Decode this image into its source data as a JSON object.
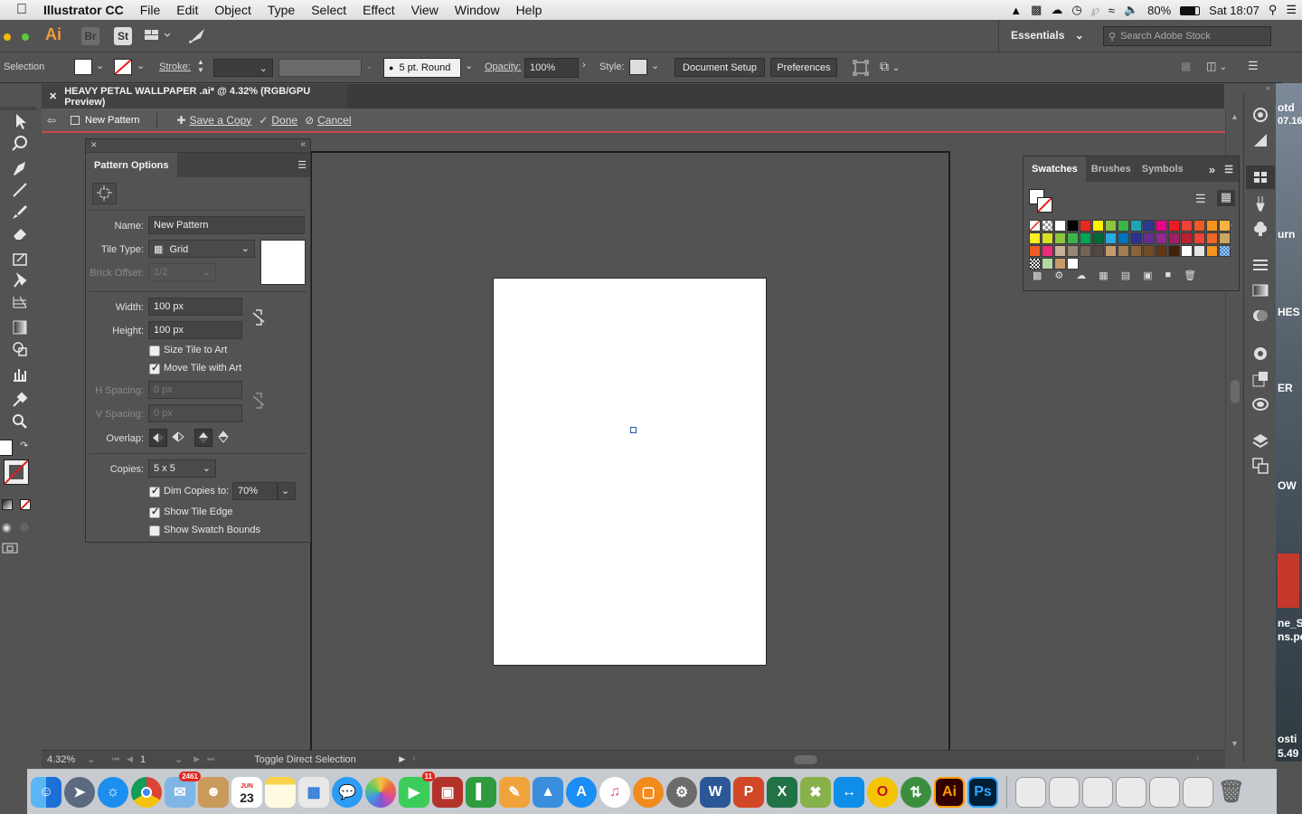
{
  "menubar": {
    "app_name": "Illustrator CC",
    "items": [
      "File",
      "Edit",
      "Object",
      "Type",
      "Select",
      "Effect",
      "View",
      "Window",
      "Help"
    ],
    "battery": "80%",
    "clock": "Sat 18:07"
  },
  "appbar": {
    "ai_logo": "Ai",
    "br": "Br",
    "st": "St",
    "workspace": "Essentials",
    "stock_search_placeholder": "Search Adobe Stock"
  },
  "control": {
    "mode": "Selection",
    "stroke_label": "Stroke:",
    "brush": "5 pt. Round",
    "opacity_label": "Opacity:",
    "opacity_value": "100%",
    "style_label": "Style:",
    "document_setup": "Document Setup",
    "preferences": "Preferences"
  },
  "document": {
    "tab_title": "HEAVY PETAL WALLPAPER .ai* @ 4.32% (RGB/GPU Preview)",
    "isolation_label": "New Pattern",
    "save_copy": "Save a Copy",
    "done": "Done",
    "cancel": "Cancel"
  },
  "pattern_options": {
    "title": "Pattern Options",
    "name_label": "Name:",
    "name_value": "New Pattern",
    "tile_type_label": "Tile Type:",
    "tile_type_value": "Grid",
    "brick_offset_label": "Brick Offset:",
    "brick_offset_value": "1/2",
    "width_label": "Width:",
    "width_value": "100 px",
    "height_label": "Height:",
    "height_value": "100 px",
    "size_tile_to_art": "Size Tile to Art",
    "move_tile_with_art": "Move Tile with Art",
    "h_spacing_label": "H Spacing:",
    "h_spacing_value": "0 px",
    "v_spacing_label": "V Spacing:",
    "v_spacing_value": "0 px",
    "overlap_label": "Overlap:",
    "copies_label": "Copies:",
    "copies_value": "5 x 5",
    "dim_copies_label": "Dim Copies to:",
    "dim_copies_value": "70%",
    "show_tile_edge": "Show Tile Edge",
    "show_swatch_bounds": "Show Swatch Bounds",
    "checks": {
      "size_tile_to_art": false,
      "move_tile_with_art": true,
      "dim_copies": true,
      "show_tile_edge": true,
      "show_swatch_bounds": false
    }
  },
  "swatches": {
    "tabs": [
      "Swatches",
      "Brushes",
      "Symbols"
    ],
    "rows": [
      [
        "#ffffff",
        "#ffffff",
        "#ffffff",
        "#000000",
        "#e8271f",
        "#fff200",
        "#8dc63f",
        "#39b54a",
        "#1fa3b6",
        "#2b3990",
        "#ec008c",
        "#ed1c24",
        "#ef4136",
        "#f15a24",
        "#f7941d",
        "#fbb040"
      ],
      [
        "#fcee21",
        "#d7df23",
        "#8cc63f",
        "#39b54a",
        "#00a651",
        "#006838",
        "#29abe2",
        "#0071bc",
        "#2e3192",
        "#662d91",
        "#92278f",
        "#9e1f63",
        "#be1e2d",
        "#ef4136",
        "#f26522",
        "#c8a95f"
      ],
      [
        "#f15a24",
        "#ee2a7b",
        "#c7b299",
        "#998675",
        "#736357",
        "#534741",
        "#c69c6d",
        "#a67c52",
        "#8c6239",
        "#754c24",
        "#603813",
        "#42210b",
        "#ffffff",
        "#e6e6e6",
        "#f7931e",
        "#8dc6ff"
      ],
      [
        "#ffffff",
        "#b3d9a0",
        "#c49a6c",
        "#ffffff"
      ]
    ]
  },
  "right_desktop_text": [
    "otd",
    "07.16",
    "urn",
    "HES",
    "ER",
    "OW",
    "ne_S",
    "ns.pc",
    "osti",
    "5.49"
  ],
  "status": {
    "zoom": "4.32%",
    "page": "1",
    "tool_hint": "Toggle Direct Selection"
  },
  "dock": {
    "calendar_month": "JUN",
    "calendar_day": "23",
    "badge_mail": "2461",
    "badge_msg": "11",
    "apps": [
      "finder",
      "launchpad",
      "safari",
      "chrome",
      "mail",
      "contacts",
      "calendar",
      "notes",
      "preview",
      "messages",
      "photos",
      "facetime",
      "photo-booth",
      "numbers",
      "pages",
      "keynote",
      "app-store",
      "itunes",
      "ibooks",
      "system-preferences",
      "word",
      "powerpoint",
      "excel",
      "xquartz",
      "teamviewer",
      "opera",
      "filezilla",
      "illustrator",
      "photoshop",
      "downloads",
      "trash"
    ],
    "ai_label": "Ai",
    "ps_label": "Ps",
    "w_label": "W",
    "p_label": "P",
    "x_label": "X",
    "o_label": "O"
  },
  "colors": {
    "accent_red": "#cc4a4a",
    "panel": "#535353",
    "panel_dark": "#424242"
  }
}
